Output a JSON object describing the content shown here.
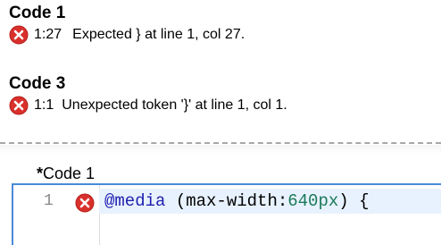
{
  "errors": [
    {
      "title": "Code 1",
      "icon": "error-icon",
      "location": "1:27",
      "message": "Expected } at line 1, col 27."
    },
    {
      "title": "Code 3",
      "icon": "error-icon",
      "location": "1:1",
      "message": "Unexpected token '}' at line 1, col 1."
    }
  ],
  "editor": {
    "dirty_marker": "*",
    "title": "Code 1",
    "line_number": "1",
    "code": {
      "at_rule": "@media",
      "open_paren": " (max-width:",
      "number": "640px",
      "rest": ") {"
    }
  },
  "colors": {
    "error_icon": "#d9302c",
    "editor_border": "#4a8ad9",
    "active_line": "#e8f2fe",
    "at_rule": "#2020b0",
    "number": "#1a7a58"
  }
}
